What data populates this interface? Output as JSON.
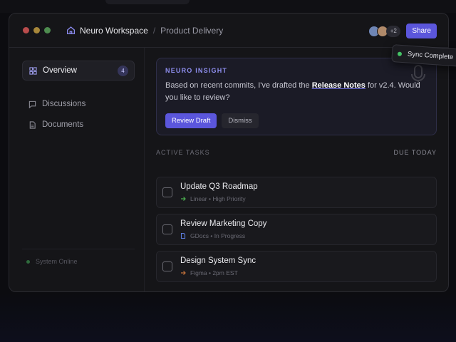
{
  "window": {
    "breadcrumb_workspace": "Neuro Workspace",
    "breadcrumb_separator": "/",
    "breadcrumb_page": "Product Delivery"
  },
  "header": {
    "avatar_more": "+2",
    "share_label": "Share"
  },
  "toast": {
    "text": "Sync Complete",
    "color": "#44c265"
  },
  "sidebar": {
    "items": [
      {
        "label": "Overview",
        "icon": "grid-icon",
        "badge": "4",
        "active": true
      },
      {
        "label": "Discussions",
        "icon": "chat-icon"
      },
      {
        "label": "Documents",
        "icon": "document-icon"
      }
    ],
    "status": "System Online"
  },
  "insight": {
    "label": "NEURO INSIGHT",
    "text_before": "Based on recent commits, I've drafted the ",
    "text_highlight": "Release Notes",
    "text_after": " for v2.4. Would you like to review?",
    "primary_label": "Review Draft",
    "secondary_label": "Dismiss"
  },
  "tasks": {
    "heading": "ACTIVE TASKS",
    "heading_right": "DUE TODAY",
    "items": [
      {
        "title": "Update Q3 Roadmap",
        "source": "Linear",
        "detail": "High Priority",
        "icon": "arrow-right-icon",
        "icon_color": "#4caf50"
      },
      {
        "title": "Review Marketing Copy",
        "source": "GDocs",
        "detail": "In Progress",
        "icon": "document-icon",
        "icon_color": "#5b7bdc"
      },
      {
        "title": "Design System Sync",
        "source": "Figma",
        "detail": "2pm EST",
        "icon": "arrow-right-icon",
        "icon_color": "#c0703a"
      }
    ]
  },
  "colors": {
    "accent": "#5b56dc",
    "insight_label": "#8f8ff0"
  }
}
